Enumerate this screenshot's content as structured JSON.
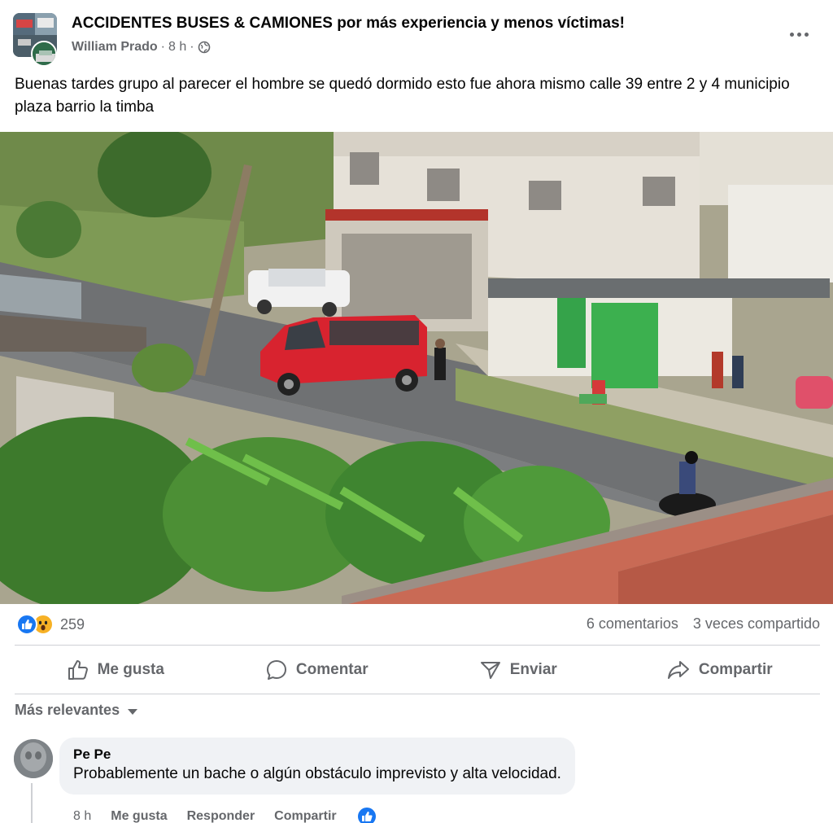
{
  "post": {
    "group_name": "ACCIDENTES BUSES & CAMIONES por más experiencia y menos víctimas!",
    "author": "William Prado",
    "separator": "·",
    "time": "8 h",
    "audience_icon": "globe-icon",
    "text": "Buenas tardes grupo al parecer el hombre se quedó dormido esto fue ahora mismo calle 39 entre 2 y 4 municipio plaza barrio la timba"
  },
  "stats": {
    "reaction_icons": [
      "like-reaction-icon",
      "wow-reaction-icon"
    ],
    "reaction_count": "259",
    "comments": "6 comentarios",
    "shares": "3 veces compartido"
  },
  "actions": {
    "like": "Me gusta",
    "comment": "Comentar",
    "send": "Enviar",
    "share": "Compartir"
  },
  "comments_sort": {
    "label": "Más relevantes"
  },
  "comments": [
    {
      "name": "Pe Pe",
      "text": "Probablemente un bache o algún obstáculo imprevisto y alta velocidad.",
      "time": "8 h",
      "like_label": "Me gusta",
      "reply_label": "Responder",
      "share_label": "Compartir"
    }
  ],
  "colors": {
    "accent": "#1877f2",
    "secondary_text": "#65676b",
    "bubble": "#f0f2f5",
    "van": "#d8232f"
  }
}
